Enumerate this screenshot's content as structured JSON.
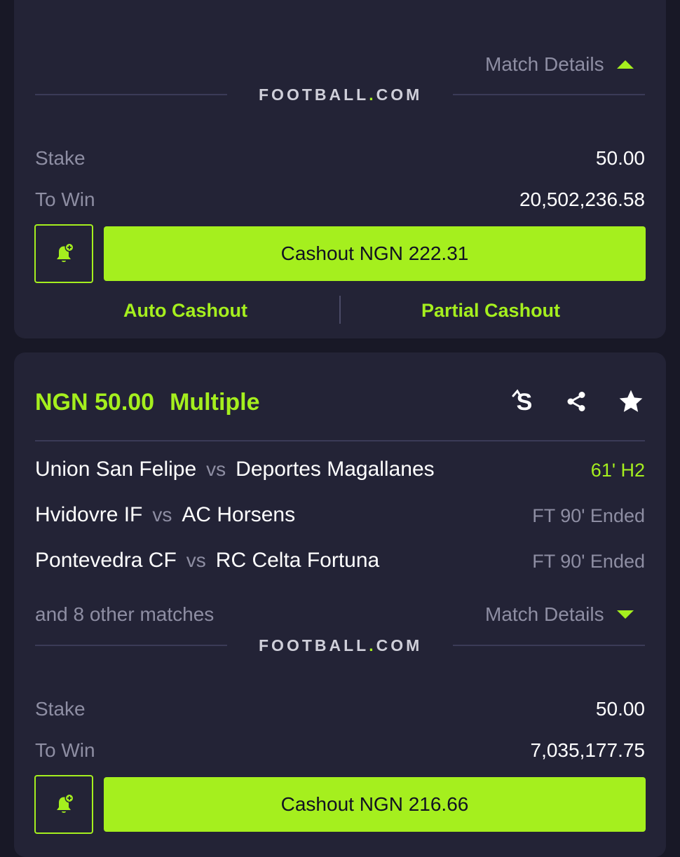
{
  "colors": {
    "accent": "#a5ef1e",
    "background": "#181826",
    "card": "#232336",
    "muted": "#8e8ea3"
  },
  "card1": {
    "match_details": {
      "label": "Match Details",
      "icon": "chevron-up-icon"
    },
    "logo": {
      "left": "FOOTBALL",
      "dot": ".",
      "right": "COM"
    },
    "stake": {
      "label": "Stake",
      "value": "50.00"
    },
    "to_win": {
      "label": "To Win",
      "value": "20,502,236.58"
    },
    "bell_icon": "bell-plus-icon",
    "cashout_label": "Cashout NGN 222.31",
    "auto_cashout": "Auto Cashout",
    "partial_cashout": "Partial Cashout"
  },
  "card2": {
    "amount": "NGN 50.00",
    "type": "Multiple",
    "icons": [
      "sportybet-s-icon",
      "share-icon",
      "star-icon"
    ],
    "vs": "vs",
    "matches": [
      {
        "home": "Union San Felipe",
        "away": "Deportes Magallanes",
        "status": "61' H2",
        "live": true
      },
      {
        "home": "Hvidovre IF",
        "away": "AC Horsens",
        "status": "FT 90' Ended",
        "live": false
      },
      {
        "home": "Pontevedra CF",
        "away": "RC Celta Fortuna",
        "status": "FT 90' Ended",
        "live": false
      }
    ],
    "other_matches": "and 8 other matches",
    "match_details": {
      "label": "Match Details",
      "icon": "chevron-down-icon"
    },
    "logo": {
      "left": "FOOTBALL",
      "dot": ".",
      "right": "COM"
    },
    "stake": {
      "label": "Stake",
      "value": "50.00"
    },
    "to_win": {
      "label": "To Win",
      "value": "7,035,177.75"
    },
    "bell_icon": "bell-plus-icon",
    "cashout_label": "Cashout NGN 216.66"
  }
}
